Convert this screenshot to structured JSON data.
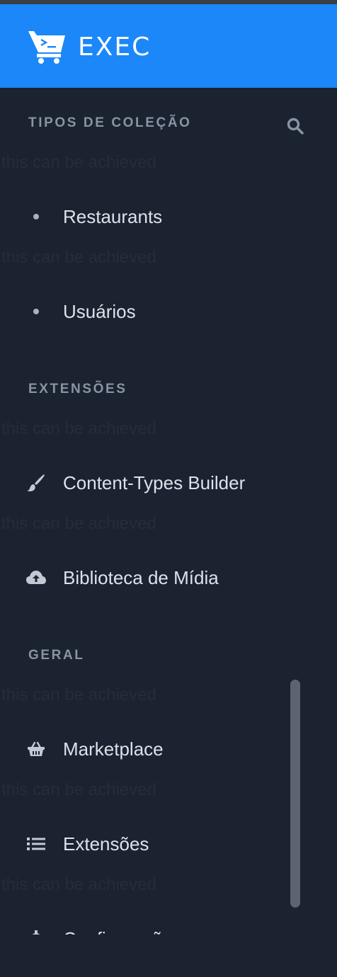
{
  "app": {
    "title": "EXEC"
  },
  "sections": {
    "collections": {
      "title": "TIPOS DE COLEÇÃO"
    },
    "extensions": {
      "title": "EXTENSÕES"
    },
    "general": {
      "title": "GERAL"
    }
  },
  "collection_items": [
    {
      "label": "Restaurants"
    },
    {
      "label": "Usuários"
    }
  ],
  "extension_items": [
    {
      "label": "Content-Types Builder",
      "icon": "paint-brush-icon"
    },
    {
      "label": "Biblioteca de Mídia",
      "icon": "cloud-upload-icon"
    }
  ],
  "general_items": [
    {
      "label": "Marketplace",
      "icon": "shopping-basket-icon"
    },
    {
      "label": "Extensões",
      "icon": "list-icon"
    },
    {
      "label": "Configurações",
      "icon": "cog-icon"
    }
  ],
  "ghost_text": "this can be achieved",
  "colors": {
    "header": "#1b87f8",
    "sidebar": "#1b2230",
    "section_title": "#8a93a3",
    "item_text": "#dde2ea"
  }
}
